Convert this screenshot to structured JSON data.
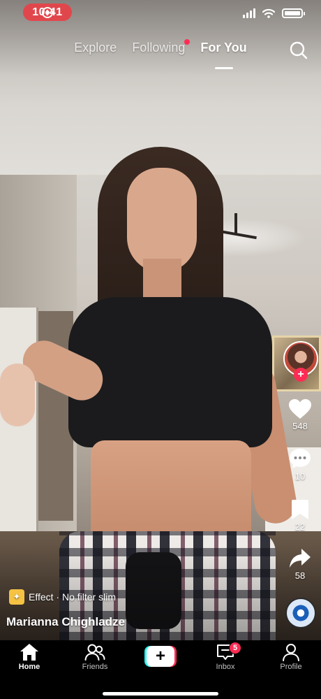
{
  "status_bar": {
    "time": "10:41"
  },
  "top_tabs": [
    {
      "label": "Explore",
      "active": false,
      "has_dot": false
    },
    {
      "label": "Following",
      "active": false,
      "has_dot": true
    },
    {
      "label": "For You",
      "active": true,
      "has_dot": false
    }
  ],
  "video": {
    "effect_label": "Effect · No filter slim",
    "username": "Marianna Chighladze"
  },
  "actions": {
    "likes": "548",
    "comments": "10",
    "saves": "22",
    "shares": "58"
  },
  "bottom_nav": {
    "home": "Home",
    "friends": "Friends",
    "inbox": "Inbox",
    "inbox_badge": "5",
    "profile": "Profile"
  },
  "colors": {
    "accent": "#fe2c55",
    "create_cyan": "#25f4ee",
    "rec_pill": "#e0474c"
  },
  "icons": [
    "search-icon",
    "heart-icon",
    "comment-icon",
    "bookmark-icon",
    "share-icon",
    "home-icon",
    "friends-icon",
    "plus-icon",
    "inbox-icon",
    "profile-icon"
  ]
}
